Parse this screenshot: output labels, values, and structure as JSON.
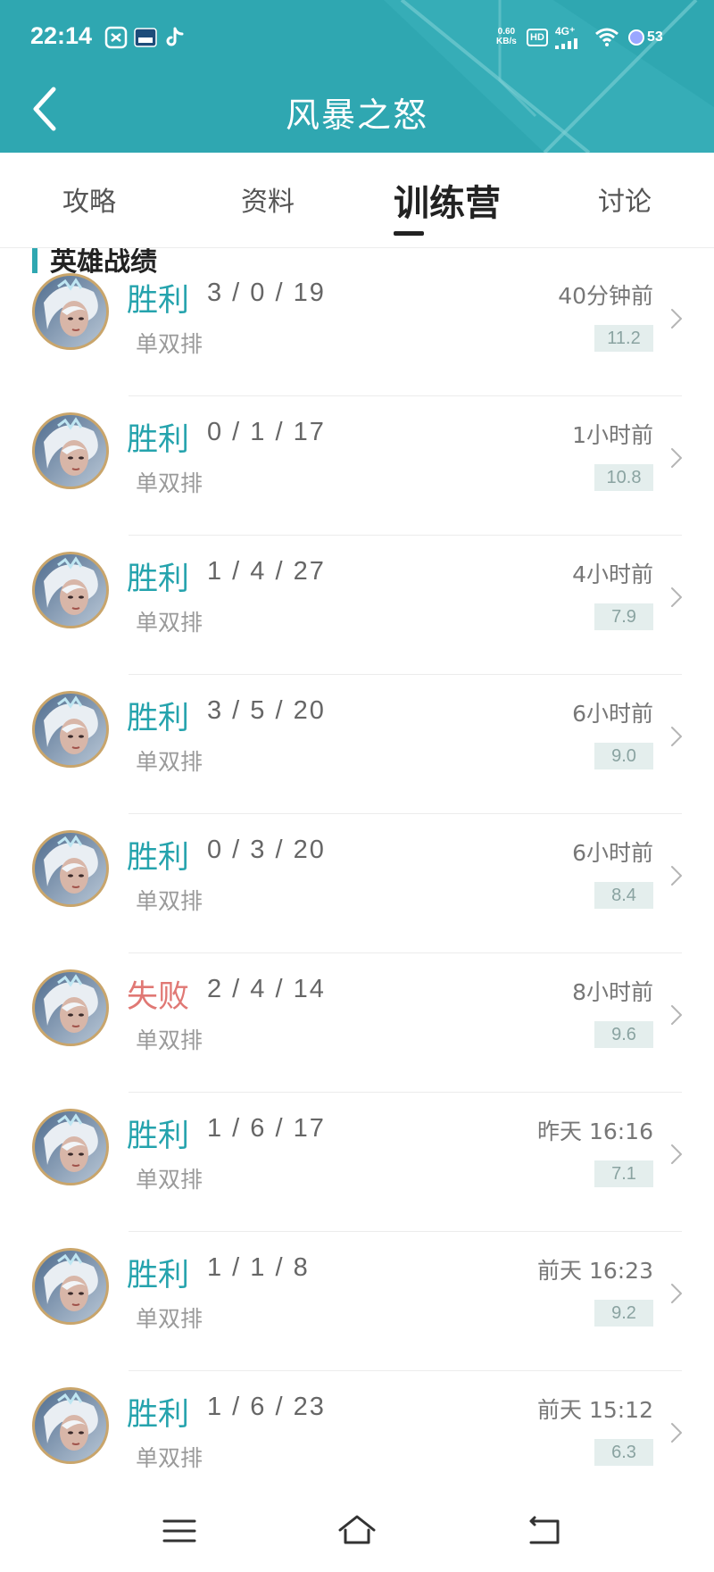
{
  "status_bar": {
    "time": "22:14",
    "network_speed_value": "0.60",
    "network_speed_unit": "KB/s",
    "hd_label": "HD",
    "signal_label": "4G⁺",
    "battery": "53",
    "icons": [
      "notification-app-icon-1",
      "notification-app-icon-2",
      "tiktok-icon",
      "wifi-icon",
      "battery-icon"
    ]
  },
  "header": {
    "title": "风暴之怒",
    "back_icon": "chevron-left-icon",
    "color": "#2fa7b1"
  },
  "tabs": [
    {
      "label": "攻略",
      "active": false
    },
    {
      "label": "资料",
      "active": false
    },
    {
      "label": "训练营",
      "active": true
    },
    {
      "label": "讨论",
      "active": false
    }
  ],
  "section": {
    "title": "英雄战绩"
  },
  "matches": [
    {
      "result": "胜利",
      "outcome": "win",
      "kda": "3 / 0 / 19",
      "mode": "单双排",
      "time": "40分钟前",
      "score": "11.2"
    },
    {
      "result": "胜利",
      "outcome": "win",
      "kda": "0 / 1 / 17",
      "mode": "单双排",
      "time": "1小时前",
      "score": "10.8"
    },
    {
      "result": "胜利",
      "outcome": "win",
      "kda": "1 / 4 / 27",
      "mode": "单双排",
      "time": "4小时前",
      "score": "7.9"
    },
    {
      "result": "胜利",
      "outcome": "win",
      "kda": "3 / 5 / 20",
      "mode": "单双排",
      "time": "6小时前",
      "score": "9.0"
    },
    {
      "result": "胜利",
      "outcome": "win",
      "kda": "0 / 3 / 20",
      "mode": "单双排",
      "time": "6小时前",
      "score": "8.4"
    },
    {
      "result": "失败",
      "outcome": "lose",
      "kda": "2 / 4 / 14",
      "mode": "单双排",
      "time": "8小时前",
      "score": "9.6"
    },
    {
      "result": "胜利",
      "outcome": "win",
      "kda": "1 / 6 / 17",
      "mode": "单双排",
      "time": "昨天 16:16",
      "score": "7.1"
    },
    {
      "result": "胜利",
      "outcome": "win",
      "kda": "1 / 1 / 8",
      "mode": "单双排",
      "time": "前天 16:23",
      "score": "9.2"
    },
    {
      "result": "胜利",
      "outcome": "win",
      "kda": "1 / 6 / 23",
      "mode": "单双排",
      "time": "前天 15:12",
      "score": "6.3"
    }
  ],
  "colors": {
    "win": "#25a3ad",
    "lose": "#e07874",
    "score_bg": "#e4eeed"
  },
  "nav": {
    "icons": [
      "menu-icon",
      "home-icon",
      "back-icon"
    ]
  }
}
